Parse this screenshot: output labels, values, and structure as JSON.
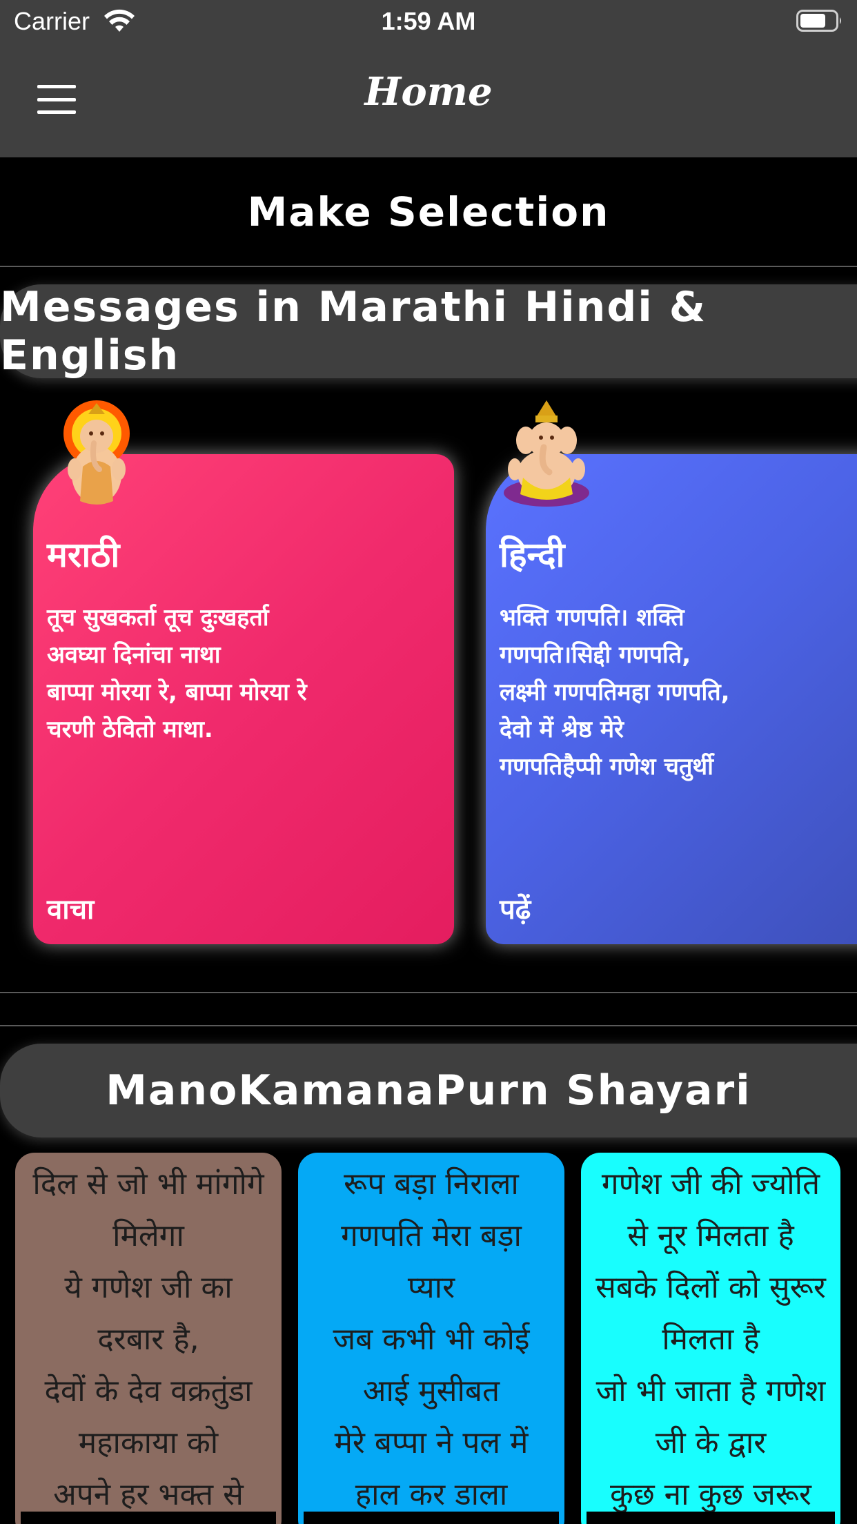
{
  "status_bar": {
    "carrier": "Carrier",
    "time": "1:59 AM"
  },
  "nav": {
    "title": "Home",
    "menu_icon": "hamburger-menu-icon"
  },
  "make_selection": "Make Selection",
  "sections": {
    "messages_title": "Messages in Marathi Hindi & English",
    "shayari_title": "ManoKamanaPurn Shayari"
  },
  "language_cards": [
    {
      "title": "मराठी",
      "lines": [
        "तूच सुखकर्ता तूच दुःखहर्ता",
        "अवघ्या दिनांचा नाथा",
        "बाप्पा मोरया रे, बाप्पा मोरया रे",
        "चरणी ठेवितो माथा."
      ],
      "action": "वाचा",
      "color": "#f02a6c"
    },
    {
      "title": "हिन्दी",
      "lines": [
        "भक्ति गणपति। शक्ति",
        "गणपति।सिद्दी गणपति,",
        "लक्ष्मी गणपतिमहा गणपति,",
        "देवो में श्रेष्ठ मेरे",
        "गणपतिहैप्पी गणेश चतुर्थी"
      ],
      "action": "पढ़ें",
      "color": "#4c63e6"
    }
  ],
  "shayari_cards": [
    {
      "color": "#8b6c61",
      "lines": [
        "दिल से जो भी मांगोगे",
        "मिलेगा",
        "ये गणेश जी का",
        "दरबार है,",
        "देवों के देव वक्रतुंडा",
        "महाकाया को",
        "अपने हर भक्त से"
      ]
    },
    {
      "color": "#05a9f5",
      "lines": [
        "रूप बड़ा निराला",
        "गणपति मेरा बड़ा",
        "प्यार",
        "जब कभी भी कोई",
        "आई मुसीबत",
        "मेरे बप्पा ने पल में",
        "हाल कर डाला"
      ]
    },
    {
      "color": "#18fefe",
      "lines": [
        "गणेश जी की ज्योति",
        "से नूर मिलता है",
        "सबके दिलों को सुरूर",
        "मिलता है",
        "जो भी जाता है गणेश",
        "जी के द्वार",
        "कुछ ना कुछ जरूर"
      ]
    }
  ]
}
